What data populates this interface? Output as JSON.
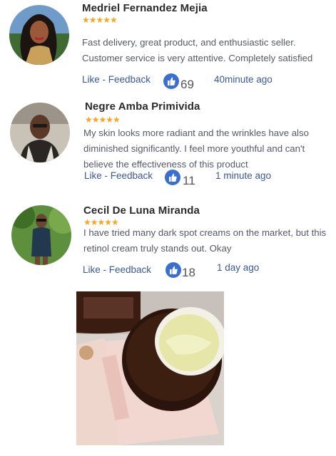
{
  "reviews": [
    {
      "name": "Medriel Fernandez Mejia",
      "stars": "★★★★★",
      "text": "Fast delivery, great product, and enthusiastic seller. Customer service is very attentive. Completely satisfied",
      "like_label": "Like - Feedback",
      "likes": "69",
      "time": "40minute ago"
    },
    {
      "name": "Negre Amba Primivida",
      "stars": "★★★★★",
      "text": "My skin looks more radiant and the wrinkles have also diminished significantly. I feel more youthful and can't believe the effectiveness of this product",
      "like_label": "Like - Feedback",
      "likes": "11",
      "time": "1 minute ago"
    },
    {
      "name": "Cecil De Luna Miranda",
      "stars": "★★★★★",
      "text": "I have tried many dark spot creams on the market, but this retinol cream truly stands out. Okay",
      "like_label": "Like - Feedback",
      "likes": "18",
      "time": "1 day ago"
    }
  ],
  "colors": {
    "star": "#f5a623",
    "link": "#3b5998",
    "thumb": "#3a6fd1"
  },
  "icons": {
    "like": "thumbs-up-icon",
    "rating": "star-icon"
  }
}
